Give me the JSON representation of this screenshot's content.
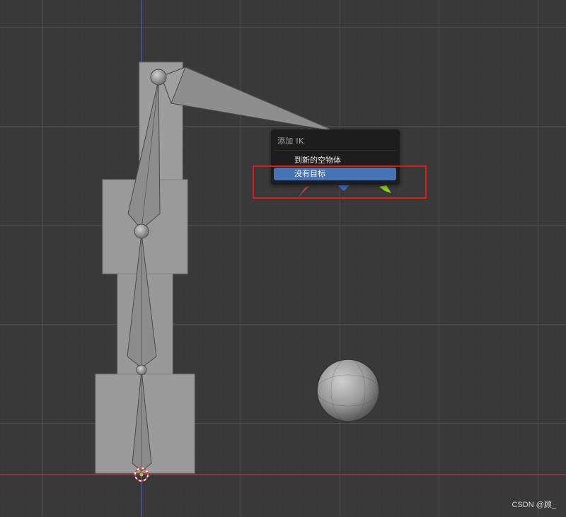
{
  "menu": {
    "title": "添加 IK",
    "items": [
      {
        "label": "到新的空物体",
        "highlighted": false
      },
      {
        "label": "没有目标",
        "highlighted": true
      }
    ]
  },
  "watermark": "CSDN @顾_",
  "colors": {
    "background": "#393939",
    "x_axis": "#b33a3a",
    "y_axis": "#3a55b3",
    "menu_bg": "#1d1d1d",
    "menu_highlight": "#4772b3",
    "annotation_box": "#e01919",
    "bone": "#8c8c8c",
    "mesh": "#9a9a9a"
  }
}
